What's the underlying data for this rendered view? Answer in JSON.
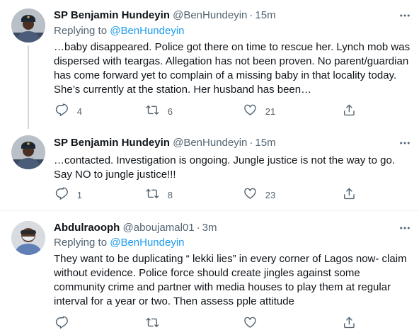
{
  "tweets": [
    {
      "name": "SP Benjamin Hundeyin",
      "handle": "@BenHundeyin",
      "dot": "·",
      "time": "15m",
      "replying_prefix": "Replying to",
      "replying_to": "@BenHundeyin",
      "lines": [
        "…baby disappeared. Police got there on time to rescue her. Lynch mob was",
        "dispersed with teargas. Allegation has not been proven. No parent/guardian",
        "has come forward yet to complain of a missing baby in that locality today.",
        "She’s currently at the station. Her husband has been…"
      ],
      "replies": "4",
      "retweets": "6",
      "likes": "21"
    },
    {
      "name": "SP Benjamin Hundeyin",
      "handle": "@BenHundeyin",
      "dot": "·",
      "time": "15m",
      "lines": [
        "…contacted. Investigation is ongoing. Jungle justice is not the way to go.",
        "Say NO to jungle justice!!!"
      ],
      "replies": "1",
      "retweets": "8",
      "likes": "23"
    },
    {
      "name": "Abdulraooph",
      "handle": "@aboujamal01",
      "dot": "·",
      "time": "3m",
      "replying_prefix": "Replying to",
      "replying_to": "@BenHundeyin",
      "lines": [
        "They want to be duplicating “ lekki lies” in every corner of Lagos now- claim",
        "without evidence. Police force should create jingles against some",
        "community crime and partner with media houses to play them at regular",
        "interval for a year or two. Then assess pple attitude"
      ]
    }
  ],
  "icons": {
    "more": "more-icon",
    "reply": "reply-icon",
    "retweet": "retweet-icon",
    "like": "like-icon",
    "share": "share-icon"
  },
  "colors": {
    "link": "#1d9bf0",
    "secondary_text": "#536471",
    "divider": "#eff3f4",
    "thread_line": "#cfd9de"
  }
}
